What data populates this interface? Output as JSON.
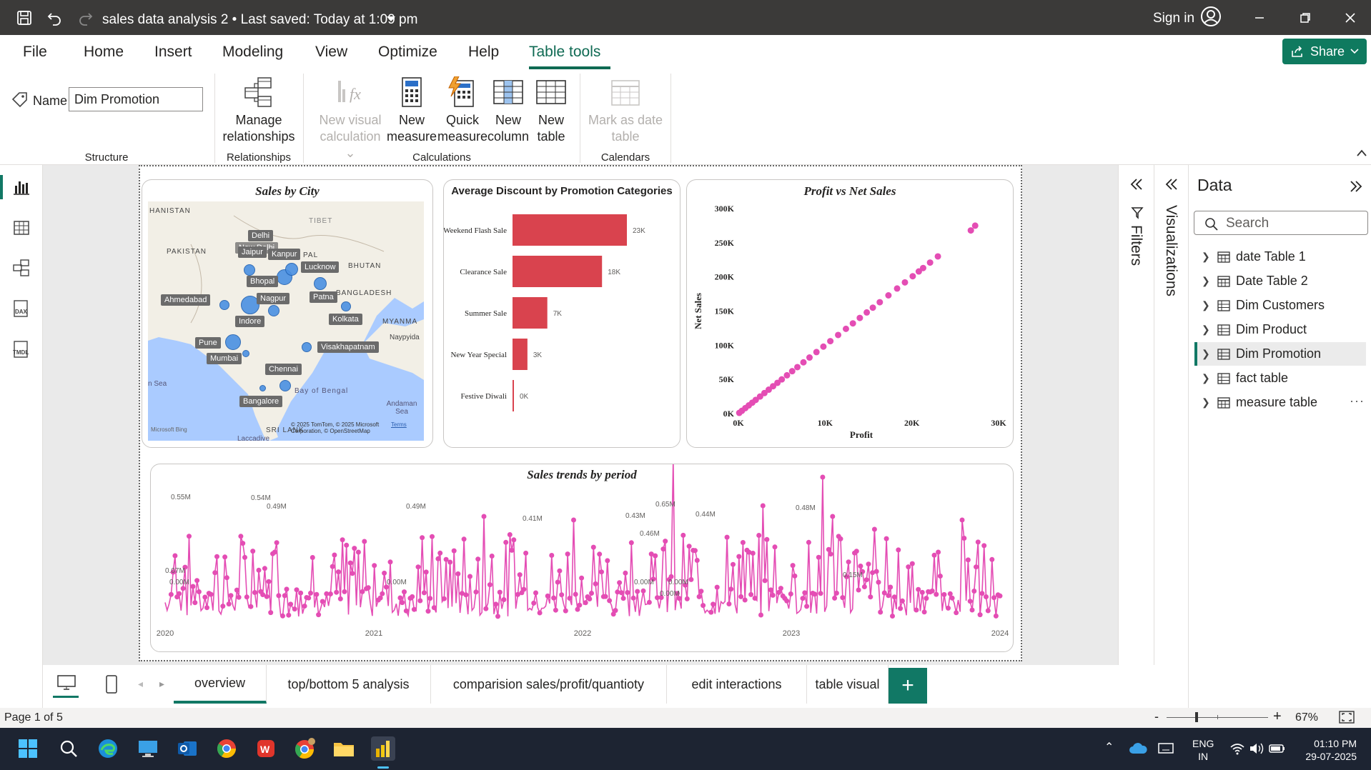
{
  "titlebar": {
    "doc_title": "sales data analysis 2  •  Last saved: Today at 1:09 pm",
    "sign_in": "Sign in"
  },
  "menu": {
    "tabs": [
      "File",
      "Home",
      "Insert",
      "Modeling",
      "View",
      "Optimize",
      "Help",
      "Table tools"
    ],
    "active": "Table tools",
    "share_label": "Share"
  },
  "ribbon": {
    "name_label": "Name",
    "name_value": "Dim Promotion",
    "groups": {
      "structure": "Structure",
      "relationships": "Relationships",
      "calculations": "Calculations",
      "calendars": "Calendars"
    },
    "buttons": {
      "manage_relationships": [
        "Manage",
        "relationships"
      ],
      "new_visual_calculation": [
        "New visual",
        "calculation ⌄"
      ],
      "new_measure": [
        "New",
        "measure"
      ],
      "quick_measure": [
        "Quick",
        "measure"
      ],
      "new_column": [
        "New",
        "column"
      ],
      "new_table": [
        "New",
        "table"
      ],
      "mark_as_date_table": [
        "Mark as date",
        "table"
      ]
    }
  },
  "visuals": {
    "map": {
      "title": "Sales by City",
      "cities": [
        "Delhi",
        "New Delhi",
        "Jaipur",
        "Kanpur",
        "Lucknow",
        "Bhopal",
        "Ahmedabad",
        "Nagpur",
        "Patna",
        "Indore",
        "Kolkata",
        "Pune",
        "Mumbai",
        "Visakhapatnam",
        "Chennai",
        "Bangalore"
      ],
      "geo_labels": [
        "HANISTAN",
        "PAKISTAN",
        "TIBET",
        "BHUTAN",
        "BANGLADESH",
        "MYANMA",
        "Naypyida",
        "Bay of Bengal",
        "Andaman Sea",
        "SRI LANK",
        "n Sea",
        "Laccadive",
        "PAL"
      ],
      "attribution": "© 2025 TomTom, © 2025 Microsoft Corporation, © OpenStreetMap",
      "terms": "Terms",
      "bing": "Microsoft Bing"
    }
  },
  "chart_data": [
    {
      "type": "bar",
      "title": "Average Discount by Promotion Categories",
      "categories": [
        "Weekend Flash Sale",
        "Clearance Sale",
        "Summer Sale",
        "New Year Special",
        "Festive Diwali"
      ],
      "values": [
        23000,
        18000,
        7000,
        3000,
        0
      ],
      "data_labels": [
        "23K",
        "18K",
        "7K",
        "3K",
        "0K"
      ],
      "color": "#d9434e"
    },
    {
      "type": "scatter",
      "title": "Profit vs Net Sales",
      "xlabel": "Profit",
      "ylabel": "Net Sales",
      "xlim": [
        0,
        30000
      ],
      "ylim": [
        0,
        300000
      ],
      "x_ticks": [
        "0K",
        "10K",
        "20K",
        "30K"
      ],
      "y_ticks": [
        "0K",
        "50K",
        "100K",
        "150K",
        "200K",
        "250K",
        "300K"
      ],
      "x": [
        100,
        400,
        800,
        1200,
        1600,
        2000,
        2500,
        3000,
        3500,
        4000,
        4500,
        5000,
        5600,
        6200,
        6800,
        7500,
        8200,
        9000,
        9800,
        10600,
        11500,
        12400,
        13200,
        14000,
        14800,
        15500,
        16300,
        17300,
        18300,
        19200,
        20100,
        20800,
        21300,
        22100,
        23000,
        26800,
        27300
      ],
      "y": [
        1000,
        4000,
        8000,
        12000,
        16000,
        20000,
        25000,
        30000,
        35000,
        40000,
        45000,
        50000,
        56000,
        62000,
        68000,
        75000,
        82000,
        90000,
        98000,
        106000,
        115000,
        124000,
        132000,
        140000,
        148000,
        155000,
        163000,
        173000,
        183000,
        192000,
        201000,
        208000,
        213000,
        221000,
        230000,
        268000,
        275000
      ],
      "color": "#e44db4"
    },
    {
      "type": "line",
      "title": "Sales trends by period",
      "x_ticks": [
        "2020",
        "2021",
        "2022",
        "2023",
        "2024"
      ],
      "peak_labels": [
        "0.55M",
        "0.54M",
        "0.49M",
        "0.49M",
        "0.41M",
        "0.43M",
        "0.46M",
        "0.65M",
        "0.44M",
        "0.48M",
        "0.07M",
        "0.00M",
        "0.00M",
        "0.00M",
        "0.00M",
        "0.00M",
        "0.15M"
      ],
      "color": "#e44db4"
    }
  ],
  "panes": {
    "filters_label": "Filters",
    "visualizations_label": "Visualizations",
    "data_title": "Data",
    "search_placeholder": "Search",
    "tables": [
      "date Table 1",
      "Date Table 2",
      "Dim Customers",
      "Dim Product",
      "Dim Promotion",
      "fact table",
      "measure table"
    ],
    "selected_table": "Dim Promotion"
  },
  "pages": {
    "tabs": [
      "overview",
      "top/bottom 5 analysis",
      "comparision sales/profit/quantioty",
      "edit interactions",
      "table visual"
    ],
    "active": "overview",
    "page_count": "Page 1 of 5",
    "zoom": "67%"
  },
  "taskbar": {
    "lang": [
      "ENG",
      "IN"
    ],
    "time": "01:10 PM",
    "date": "29-07-2025"
  }
}
